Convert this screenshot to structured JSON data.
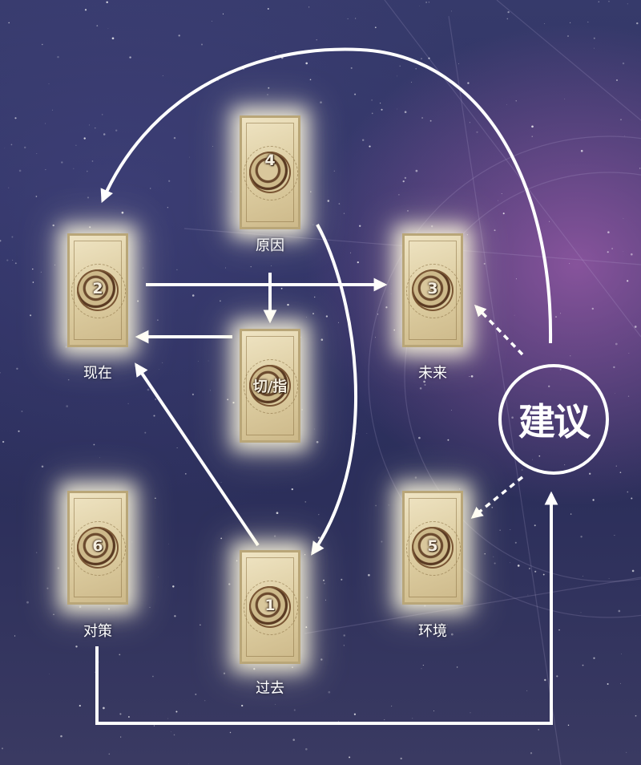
{
  "cards": [
    {
      "id": "4",
      "number": "4",
      "label": "原因"
    },
    {
      "id": "2",
      "number": "2",
      "label": "现在"
    },
    {
      "id": "3",
      "number": "3",
      "label": "未来"
    },
    {
      "id": "key",
      "number": "切/指",
      "label": ""
    },
    {
      "id": "6",
      "number": "6",
      "label": "对策"
    },
    {
      "id": "1",
      "number": "1",
      "label": "过去"
    },
    {
      "id": "5",
      "number": "5",
      "label": "环境"
    }
  ],
  "advice": {
    "label": "建议"
  },
  "colors": {
    "arrow": "#ffffff",
    "card": "#e3d5ad",
    "background": "#2c2f5b",
    "glow": "#fff8dc"
  }
}
